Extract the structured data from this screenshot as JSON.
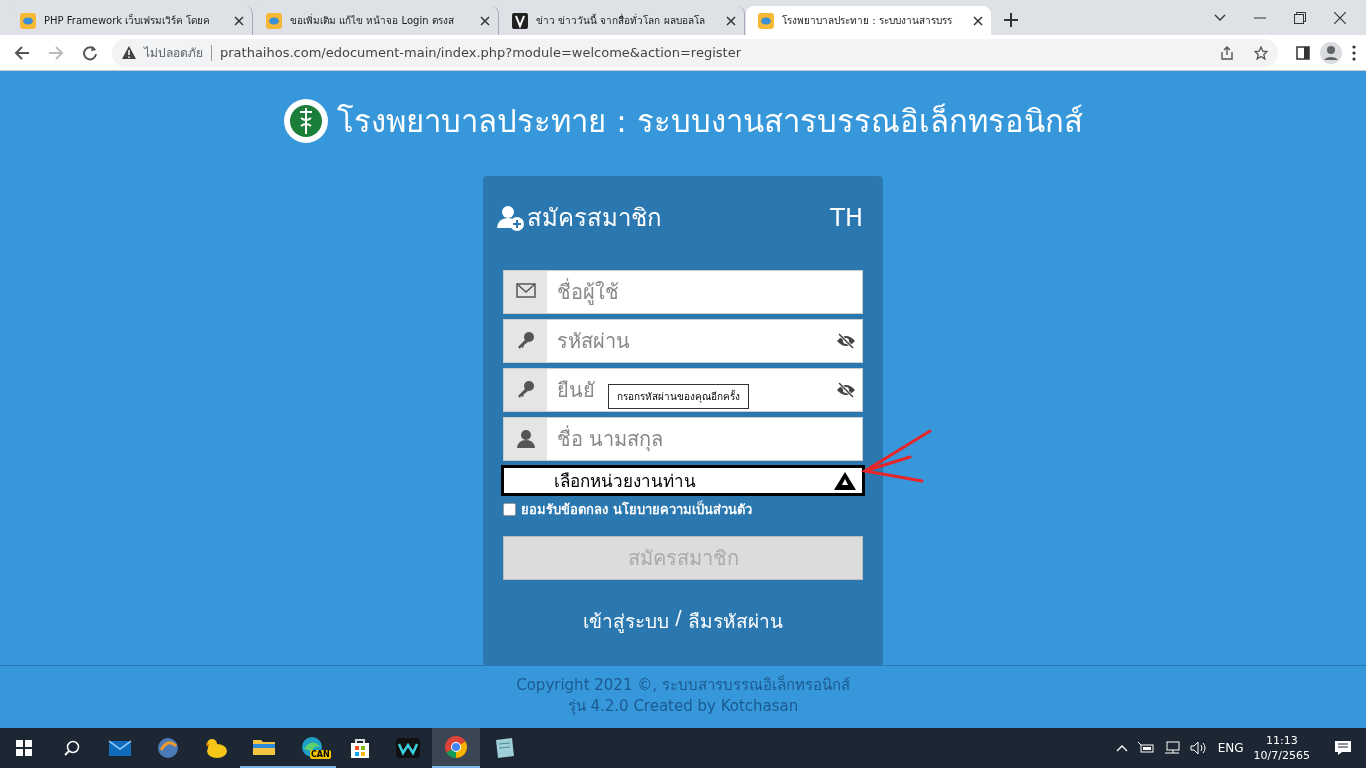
{
  "browser": {
    "tabs": [
      {
        "title": "PHP Framework เว็บเฟรมเวิร์ค โดยค",
        "selected": false
      },
      {
        "title": "ขอเพิ่มเติม แก้ไข หน้าจอ Login ตรงส",
        "selected": false
      },
      {
        "title": "ข่าว ข่าววันนี้ จากสื่อทั่วโลก ผลบอลโล",
        "selected": false
      },
      {
        "title": "โรงพยาบาลประทาย : ระบบงานสารบรร",
        "selected": true
      }
    ],
    "nav_buttons": [
      {
        "kind": "back",
        "disabled": false
      },
      {
        "kind": "forward",
        "disabled": true
      },
      {
        "kind": "reload",
        "disabled": false
      }
    ],
    "address_bar": {
      "security_label": "ไม่ปลอดภัย",
      "url": "prathaihos.com/edocument-main/index.php?module=welcome&action=register"
    }
  },
  "page": {
    "title": "โรงพยาบาลประทาย : ระบบงานสารบรรณอิเล็กทรอนิกส์"
  },
  "form": {
    "heading": "สมัครสมาชิก",
    "language": "TH",
    "fields": [
      {
        "kind": "email",
        "placeholder": "ชื่อผู้ใช้"
      },
      {
        "kind": "password",
        "placeholder": "รหัสผ่าน"
      },
      {
        "kind": "password",
        "placeholder": "ยืนยั",
        "tooltip": "กรอกรหัสผ่านของคุณอีกครั้ง"
      },
      {
        "kind": "person",
        "placeholder": "ชื่อ นามสกุล"
      }
    ],
    "department_select": {
      "value": "เลือกหน่วยงานท่าน"
    },
    "agreement": {
      "checked": false,
      "text": "ยอมรับข้อตกลง",
      "link": "นโยบายความเป็นส่วนตัว"
    },
    "submit": {
      "label": "สมัครสมาชิก",
      "disabled": true
    },
    "links": [
      {
        "label": "เข้าสู่ระบบ"
      },
      {
        "label": "ลืมรหัสผ่าน"
      }
    ],
    "link_separator": "/"
  },
  "footer": {
    "lines": [
      "Copyright 2021 ©, ระบบสารบรรณอิเล็กทรอนิกส์",
      "รุ่น 4.2.0 Created by Kotchasan"
    ]
  },
  "taskbar": {
    "apps": [
      {
        "kind": "mail",
        "running": false,
        "selected": false
      },
      {
        "kind": "orb",
        "running": false,
        "selected": false
      },
      {
        "kind": "duck",
        "running": false,
        "selected": false
      },
      {
        "kind": "folder",
        "running": true,
        "selected": false
      },
      {
        "kind": "edge",
        "running": true,
        "selected": false,
        "badge": "CAN"
      },
      {
        "kind": "store",
        "running": false,
        "selected": false
      },
      {
        "kind": "w",
        "running": false,
        "selected": false
      },
      {
        "kind": "chrome",
        "running": true,
        "selected": true
      },
      {
        "kind": "notebook",
        "running": false,
        "selected": false
      }
    ],
    "tray": {
      "language": "ENG",
      "time": "11:13",
      "date": "10/7/2565"
    }
  }
}
